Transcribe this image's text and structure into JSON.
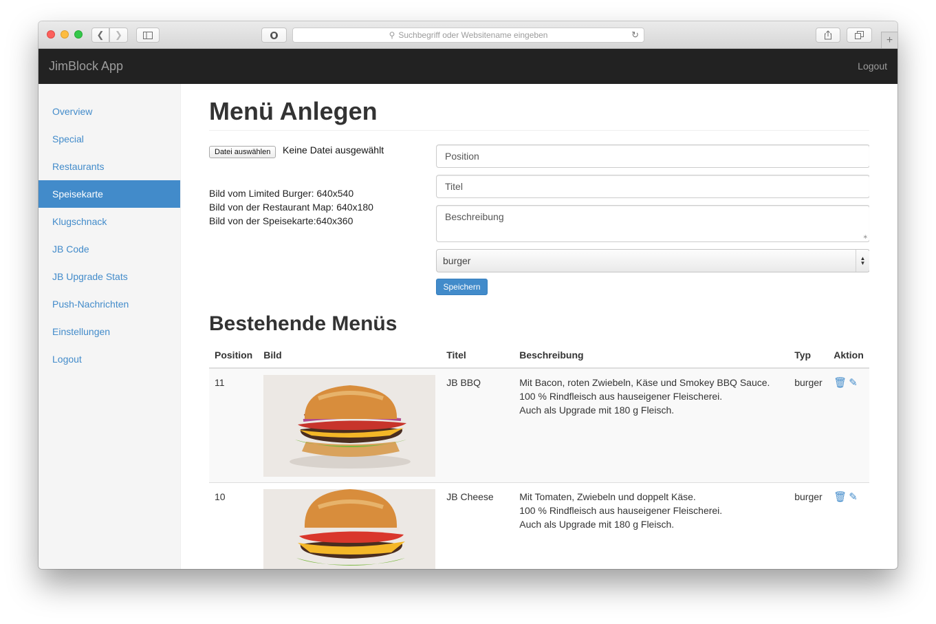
{
  "browser": {
    "url_placeholder": "Suchbegriff oder Websitename eingeben",
    "new_tab_glyph": "+"
  },
  "navbar": {
    "brand": "JimBlock App",
    "logout": "Logout"
  },
  "sidebar": {
    "items": [
      {
        "label": "Overview"
      },
      {
        "label": "Special"
      },
      {
        "label": "Restaurants"
      },
      {
        "label": "Speisekarte"
      },
      {
        "label": "Klugschnack"
      },
      {
        "label": "JB Code"
      },
      {
        "label": "JB Upgrade Stats"
      },
      {
        "label": "Push-Nachrichten"
      },
      {
        "label": "Einstellungen"
      },
      {
        "label": "Logout"
      }
    ],
    "active": "Speisekarte"
  },
  "form": {
    "heading": "Menü Anlegen",
    "file_button": "Datei auswählen",
    "file_status": "Keine Datei ausgewählt",
    "hints": [
      "Bild vom Limited Burger: 640x540",
      "Bild von der Restaurant Map: 640x180",
      "Bild von der Speisekarte:640x360"
    ],
    "position_placeholder": "Position",
    "title_placeholder": "Titel",
    "description_placeholder": "Beschreibung",
    "type_selected": "burger",
    "save_label": "Speichern"
  },
  "list": {
    "heading": "Bestehende Menüs",
    "columns": [
      "Position",
      "Bild",
      "Titel",
      "Beschreibung",
      "Typ",
      "Aktion"
    ],
    "rows": [
      {
        "position": "11",
        "title": "JB BBQ",
        "description": [
          "Mit Bacon, roten Zwiebeln, Käse und Smokey BBQ Sauce.",
          "100 % Rindfleisch aus hauseigener Fleischerei.",
          "Auch als Upgrade mit 180 g Fleisch."
        ],
        "type": "burger"
      },
      {
        "position": "10",
        "title": "JB Cheese",
        "description": [
          "Mit Tomaten, Zwiebeln und doppelt Käse.",
          "100 % Rindfleisch aus hauseigener Fleischerei.",
          "Auch als Upgrade mit 180 g Fleisch."
        ],
        "type": "burger"
      }
    ]
  },
  "colors": {
    "accent": "#428bca",
    "navbar": "#222222",
    "sidebar": "#f5f5f5"
  }
}
